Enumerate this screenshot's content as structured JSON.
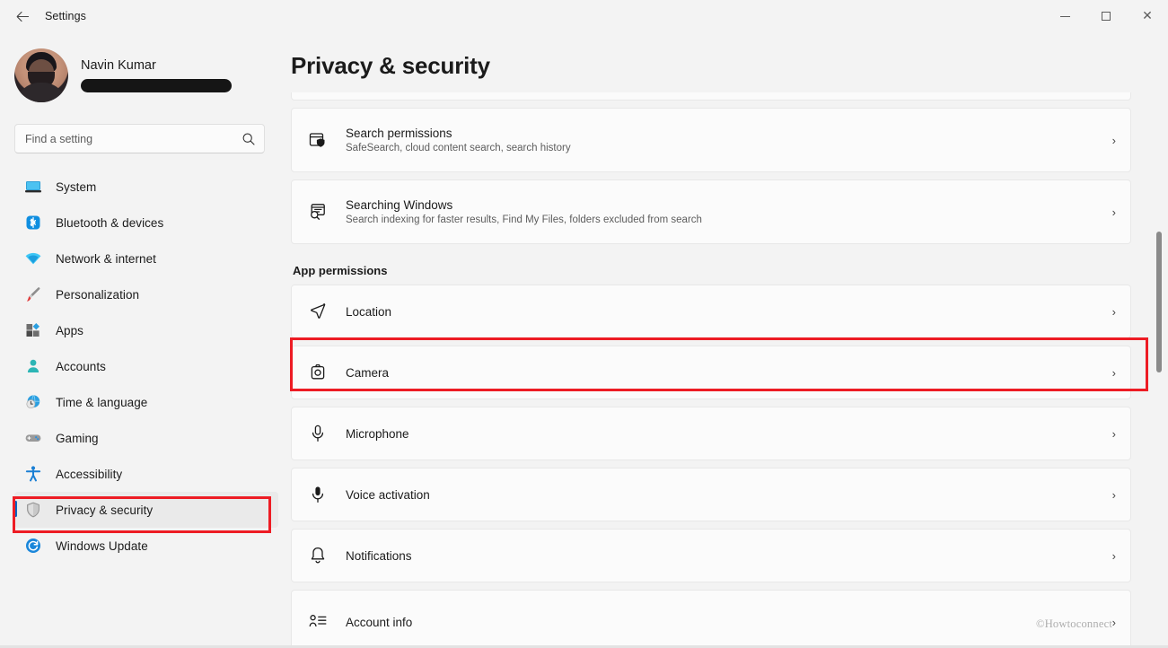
{
  "titlebar": {
    "back_icon": "back-arrow-icon",
    "app_title": "Settings",
    "minimize_label": "—",
    "maximize_label": "□",
    "close_label": "✕"
  },
  "account": {
    "name": "Navin Kumar",
    "email_redacted": true,
    "avatar_icon": "user-avatar"
  },
  "search": {
    "placeholder": "Find a setting",
    "value": "",
    "icon": "search-icon"
  },
  "sidebar": {
    "items": [
      {
        "label": "System",
        "icon": "system-monitor-icon",
        "selected": false
      },
      {
        "label": "Bluetooth & devices",
        "icon": "bluetooth-icon",
        "selected": false
      },
      {
        "label": "Network & internet",
        "icon": "wifi-icon",
        "selected": false
      },
      {
        "label": "Personalization",
        "icon": "paintbrush-icon",
        "selected": false
      },
      {
        "label": "Apps",
        "icon": "apps-grid-icon",
        "selected": false
      },
      {
        "label": "Accounts",
        "icon": "person-icon",
        "selected": false
      },
      {
        "label": "Time & language",
        "icon": "clock-globe-icon",
        "selected": false
      },
      {
        "label": "Gaming",
        "icon": "gamepad-icon",
        "selected": false
      },
      {
        "label": "Accessibility",
        "icon": "accessibility-icon",
        "selected": false
      },
      {
        "label": "Privacy & security",
        "icon": "shield-icon",
        "selected": true
      },
      {
        "label": "Windows Update",
        "icon": "update-refresh-icon",
        "selected": false
      }
    ]
  },
  "main": {
    "page_title": "Privacy & security",
    "cards_top": [
      {
        "title": "Search permissions",
        "subtitle": "SafeSearch, cloud content search, search history",
        "icon": "search-permissions-icon",
        "chevron": "›"
      },
      {
        "title": "Searching Windows",
        "subtitle": "Search indexing for faster results, Find My Files, folders excluded from search",
        "icon": "searching-windows-icon",
        "chevron": "›"
      }
    ],
    "section_title": "App permissions",
    "permissions": [
      {
        "title": "Location",
        "icon": "location-arrow-icon",
        "chevron": "›",
        "highlighted": false
      },
      {
        "title": "Camera",
        "icon": "camera-icon",
        "chevron": "›",
        "highlighted": true
      },
      {
        "title": "Microphone",
        "icon": "microphone-icon",
        "chevron": "›",
        "highlighted": false
      },
      {
        "title": "Voice activation",
        "icon": "voice-activation-icon",
        "chevron": "›",
        "highlighted": false
      },
      {
        "title": "Notifications",
        "icon": "bell-icon",
        "chevron": "›",
        "highlighted": false
      },
      {
        "title": "Account info",
        "icon": "account-info-icon",
        "chevron": "›",
        "highlighted": false
      }
    ]
  },
  "watermark": "©Howtoconnect",
  "colors": {
    "accent": "#0067c0",
    "annotation": "#ed1c24",
    "window_bg": "#f3f3f3",
    "card_bg": "#fbfbfb"
  }
}
